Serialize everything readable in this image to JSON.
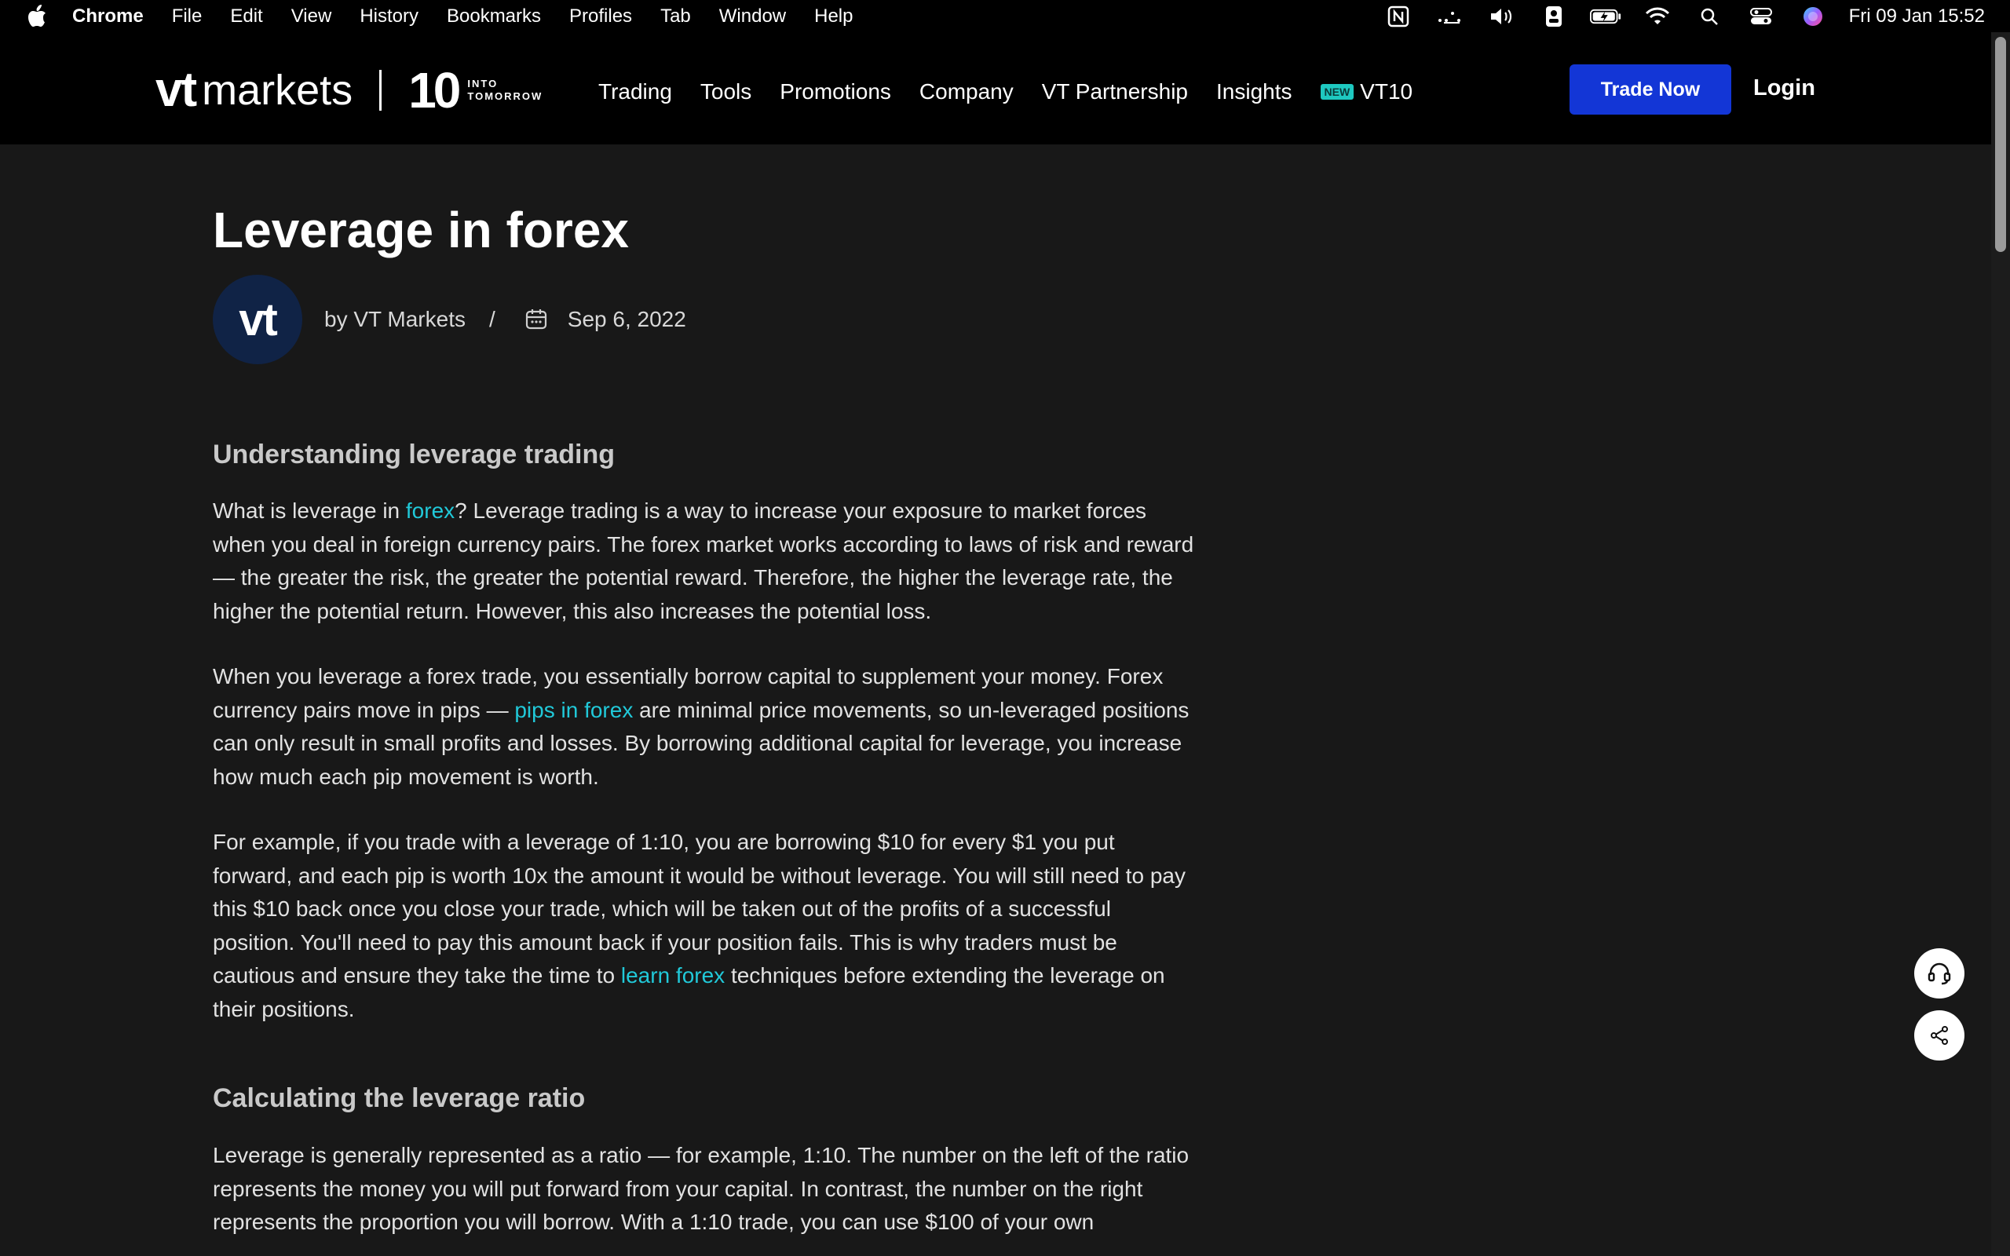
{
  "menubar": {
    "app": "Chrome",
    "items": [
      "File",
      "Edit",
      "View",
      "History",
      "Bookmarks",
      "Profiles",
      "Tab",
      "Window",
      "Help"
    ],
    "clock": "Fri 09 Jan  15:52"
  },
  "header": {
    "logo_vt": "vt",
    "logo_markets": "markets",
    "logo_ten": "10",
    "logo_tagline_1": "INTO",
    "logo_tagline_2": "TOMORROW",
    "nav": [
      "Trading",
      "Tools",
      "Promotions",
      "Company",
      "VT Partnership",
      "Insights"
    ],
    "new_badge": "NEW",
    "vt10": "VT10",
    "trade_now": "Trade Now",
    "login": "Login"
  },
  "article": {
    "title": "Leverage in forex",
    "avatar": "vt",
    "byline": "by VT Markets",
    "separator": "/",
    "date": "Sep 6, 2022",
    "section1": "Understanding leverage trading",
    "p1": {
      "a": "What is leverage in ",
      "link": "forex",
      "b": "? Leverage trading is a way to increase your exposure to market forces when you deal in foreign currency pairs. The forex market works according to laws of risk and reward — the greater the risk, the greater the potential reward. Therefore, the higher the leverage rate, the higher the potential return. However, this also increases the potential loss."
    },
    "p2": {
      "a": "When you leverage a forex trade, you essentially borrow capital to supplement your money. Forex currency pairs move in pips — ",
      "link": "pips in forex",
      "b": " are minimal price movements, so un-leveraged positions can only result in small profits and losses. By borrowing additional capital for leverage, you increase how much each pip movement is worth."
    },
    "p3": {
      "a": "For example, if you trade with a leverage of 1:10, you are borrowing $10 for every $1 you put forward, and each pip is worth 10x the amount it would be without leverage. You will still need to pay this $10 back once you close your trade, which will be taken out of the profits of a successful position. You'll need to pay this amount back if your position fails. This is why traders must be cautious and ensure they take the time to ",
      "link": "learn forex",
      "b": " techniques before extending the leverage on their positions."
    },
    "section2": "Calculating the leverage ratio",
    "p4": "Leverage is generally represented as a ratio — for example, 1:10. The number on the left of the ratio represents the money you will put forward from your capital. In contrast, the number on the right represents the proportion you will borrow. With a 1:10 trade, you can use $100 of your own"
  },
  "colors": {
    "accent_link": "#21c9d9",
    "button_blue": "#1336d6",
    "background": "#181818"
  }
}
